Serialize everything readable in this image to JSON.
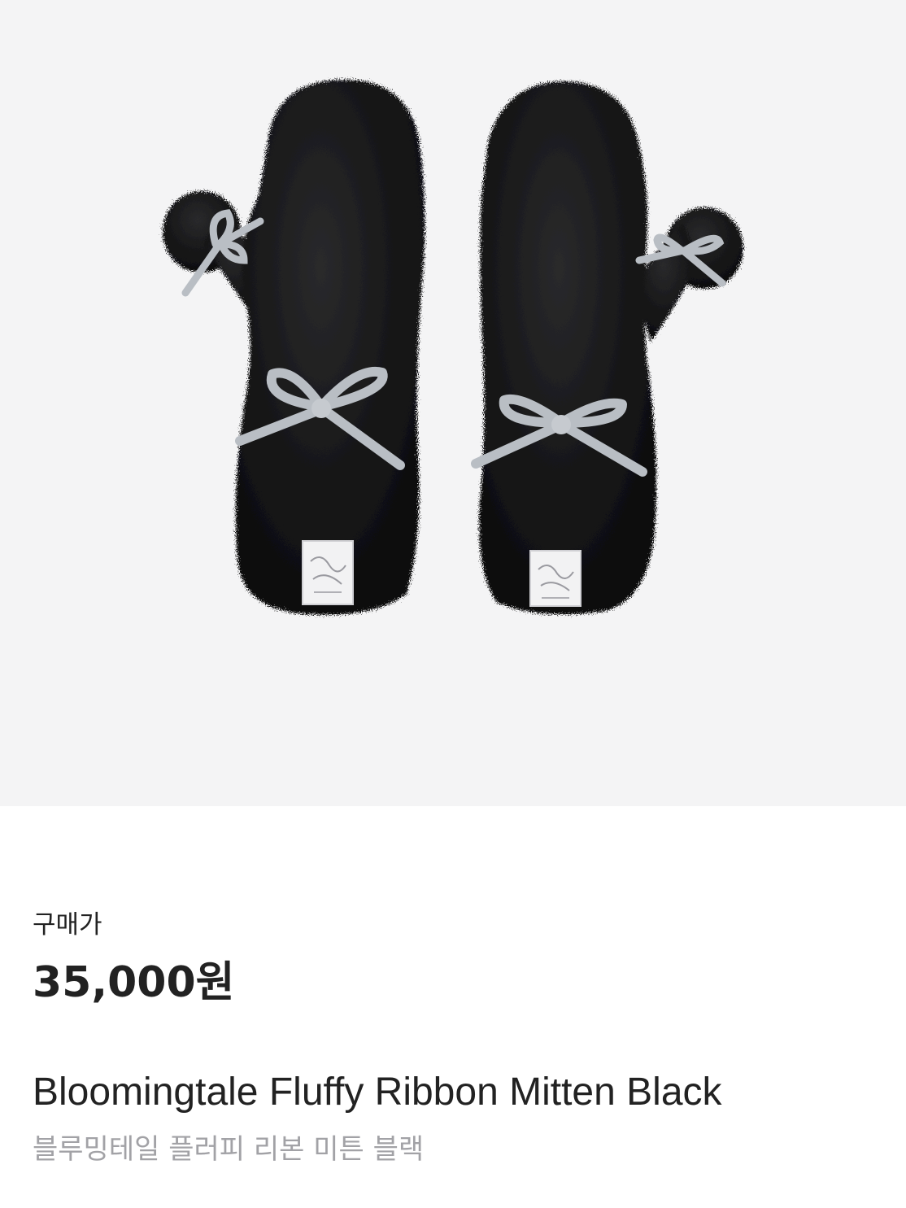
{
  "product": {
    "image_icon": "mitten-pair-photo",
    "image_background": "#f4f4f5",
    "fur_color": "#141414",
    "ribbon_color": "#b9bec4"
  },
  "price_section": {
    "label": "구매가",
    "price": "35,000원"
  },
  "names": {
    "english": "Bloomingtale Fluffy Ribbon Mitten Black",
    "korean": "블루밍테일 플러피 리본 미튼 블랙"
  },
  "colors": {
    "text_primary": "#222222",
    "text_secondary": "#a2a2a6"
  }
}
